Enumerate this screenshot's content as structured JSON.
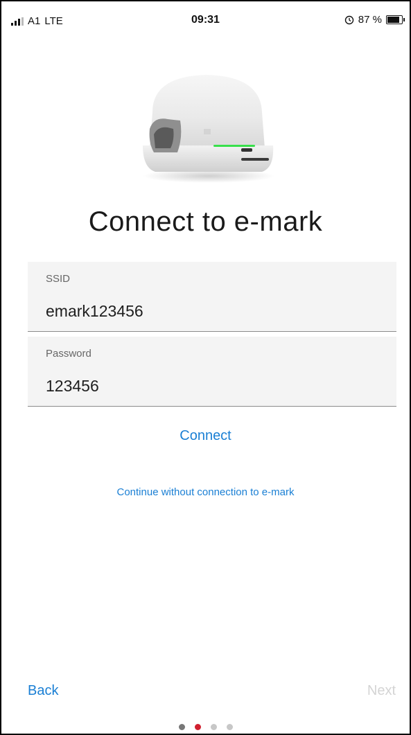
{
  "status_bar": {
    "carrier": "A1",
    "network": "LTE",
    "time": "09:31",
    "alarm_icon": "clock-icon",
    "battery": "87 %",
    "battery_level": 0.87
  },
  "device_image": {
    "icon": "printer-device-image"
  },
  "title": "Connect to e-mark",
  "form": {
    "ssid": {
      "label": "SSID",
      "value": "emark123456"
    },
    "password": {
      "label": "Password",
      "value": "123456"
    }
  },
  "actions": {
    "connect": "Connect",
    "continue_without": "Continue without connection to e-mark"
  },
  "nav": {
    "back": "Back",
    "next": "Next"
  },
  "pagination": {
    "total": 4,
    "active_index": 1,
    "colors": {
      "active": "#d0202f",
      "visited": "#777777",
      "inactive": "#c7c7c7"
    }
  },
  "colors": {
    "accent": "#1a7fd4",
    "disabled": "#d4d4d4"
  }
}
